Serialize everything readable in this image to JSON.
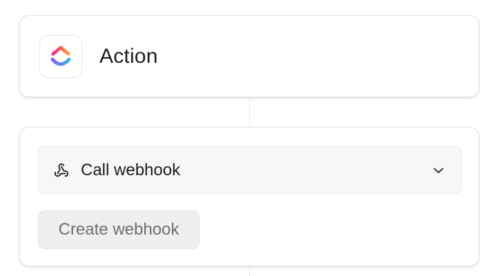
{
  "trigger_card": {
    "app_icon": "clickup-logo-icon",
    "title": "Action"
  },
  "action_card": {
    "select": {
      "icon": "webhook-icon",
      "value": "Call webhook",
      "chevron": "chevron-down-icon"
    },
    "create_button": {
      "label": "Create webhook",
      "disabled": true
    }
  },
  "colors": {
    "logo_gradient_top": [
      "#f72a8a",
      "#ff9b2f"
    ],
    "logo_gradient_bottom": [
      "#8a5cff",
      "#39b3f5"
    ],
    "text_primary": "#1c1c1c",
    "text_disabled": "#6e6e6e",
    "button_disabled_bg": "#efefef",
    "select_bg": "#f7f7f7"
  }
}
